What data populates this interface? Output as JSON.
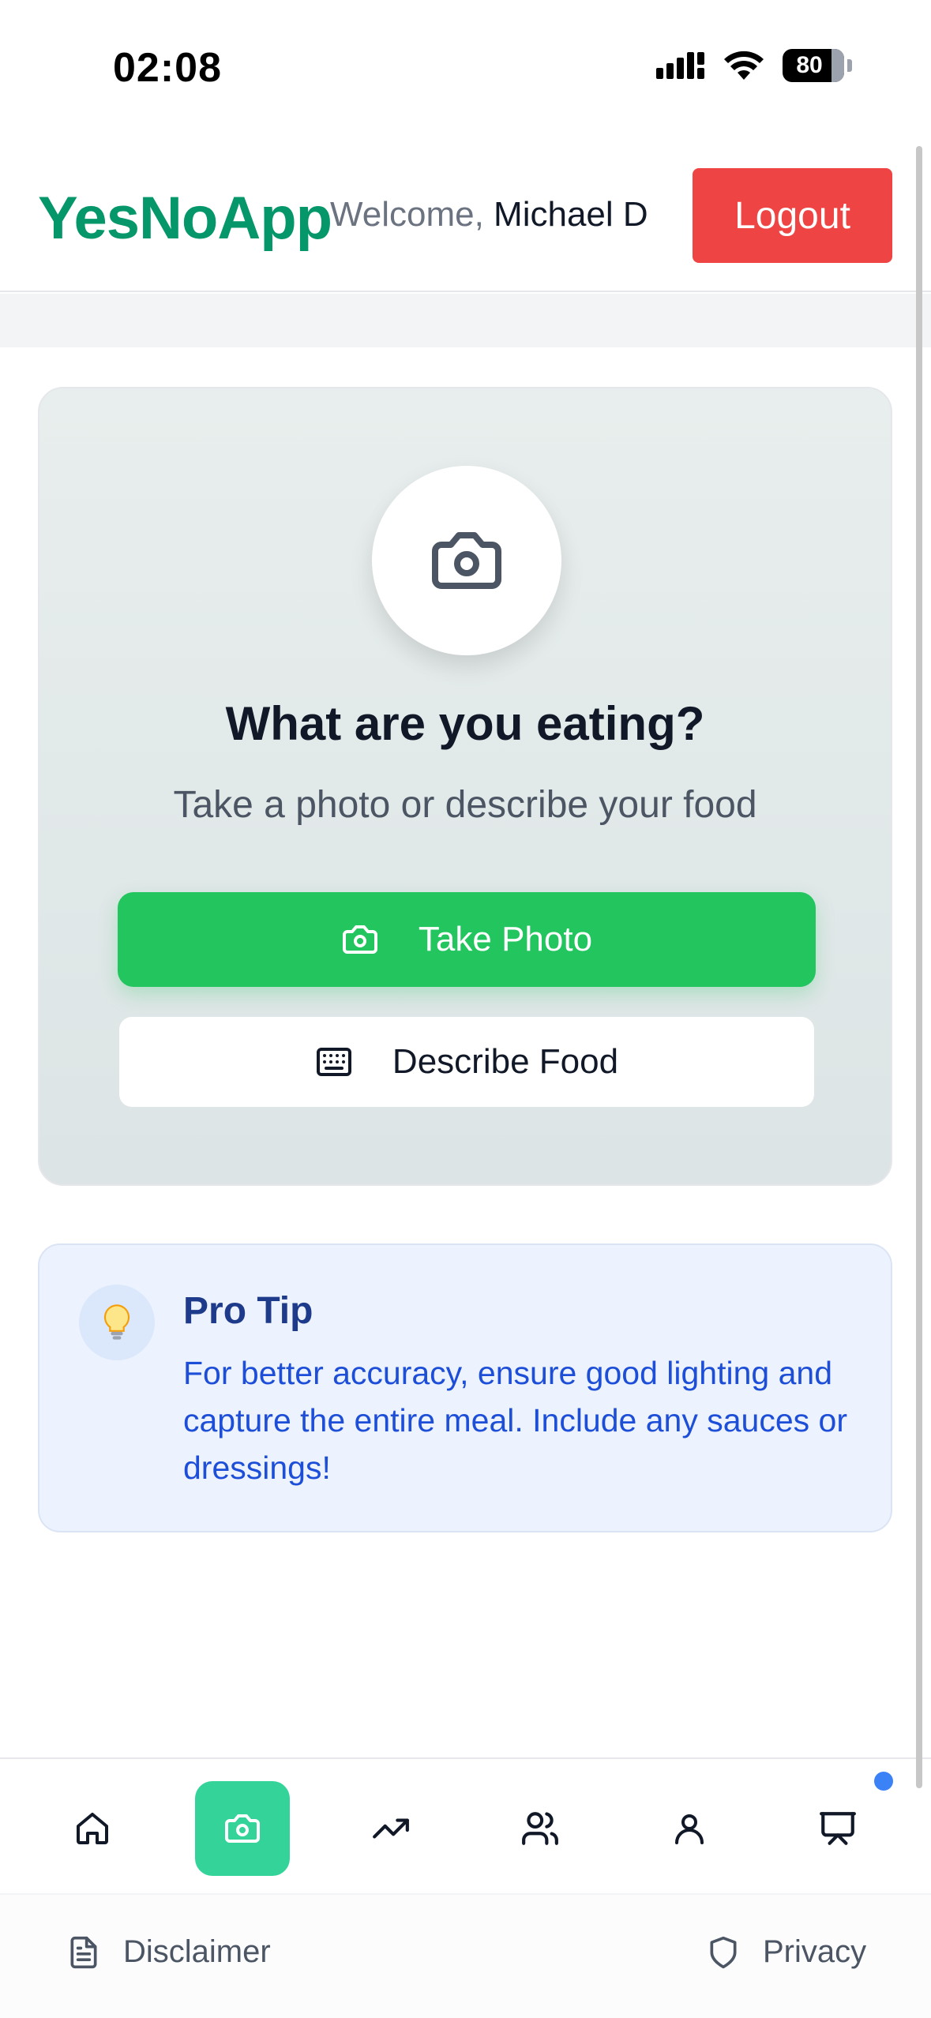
{
  "status_bar": {
    "time": "02:08",
    "battery": "80"
  },
  "header": {
    "brand": "YesNoApp",
    "welcome_label": "Welcome,",
    "user_name": "Michael D",
    "logout_label": "Logout",
    "colors": {
      "brand": "#059669",
      "logout": "#ef4444"
    }
  },
  "main": {
    "icon": "camera-icon",
    "title": "What are you eating?",
    "subtitle": "Take a photo or describe your food",
    "take_photo_label": "Take Photo",
    "describe_food_label": "Describe Food",
    "colors": {
      "primary": "#22c55e"
    }
  },
  "tip": {
    "icon": "lightbulb-icon",
    "title": "Pro Tip",
    "text": "For better accuracy, ensure good lighting and capture the entire meal. Include any sauces or dressings!"
  },
  "bottom_nav": {
    "items": [
      {
        "icon": "home-icon",
        "active": false
      },
      {
        "icon": "camera-icon",
        "active": true
      },
      {
        "icon": "trending-up-icon",
        "active": false
      },
      {
        "icon": "users-icon",
        "active": false
      },
      {
        "icon": "user-icon",
        "active": false
      },
      {
        "icon": "presentation-icon",
        "active": false,
        "notification": true
      }
    ],
    "colors": {
      "active": "#34d399",
      "notification": "#3b82f6"
    }
  },
  "footer": {
    "disclaimer_label": "Disclaimer",
    "privacy_label": "Privacy"
  }
}
